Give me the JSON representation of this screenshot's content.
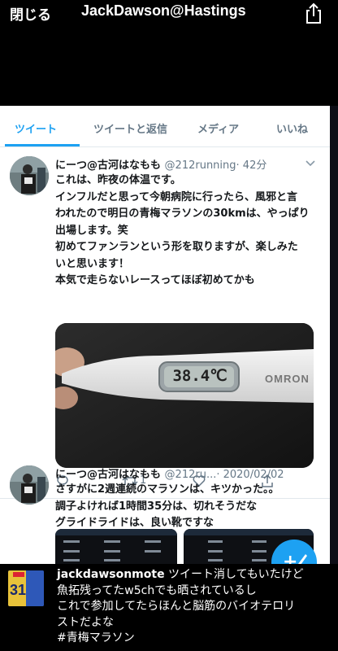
{
  "topbar": {
    "close_label": "閉じる",
    "title": "JackDawson@Hastings",
    "share_icon": "share-icon"
  },
  "tabs": [
    {
      "label": "ツイート",
      "active": true
    },
    {
      "label": "ツイートと返信",
      "active": false
    },
    {
      "label": "メディア",
      "active": false
    },
    {
      "label": "いいね",
      "active": false
    }
  ],
  "tweet1": {
    "name": "にーつ@古河はなもも",
    "handle": "@212running",
    "time": "· 42分",
    "lines": [
      "これは、昨夜の体温です。",
      "インフルだと思って今朝病院に行ったら、風邪と言",
      "われたので明日の青梅マラソンの30kmは、やっぱり",
      "出場します。笑",
      "初めてファンランという形を取りますが、楽しみた",
      "いと思います！",
      "本気で走らないレースってほぼ初めてかも"
    ],
    "thermometer_reading": "38.4℃",
    "thermometer_brand": "OMRON",
    "retweets": "1",
    "brand_color": "#1da1f2"
  },
  "tweet2": {
    "name": "にーつ@古河はなもも",
    "handle": "@212ru...",
    "time": "· 2020/02/02",
    "lines": [
      "さすがに2週連続のマラソンは、キツかった。。",
      "調子よければ1時間35分は、切れそうだな",
      "グライドライドは、良い靴ですな"
    ]
  },
  "comment": {
    "user": "jackdawsonmote",
    "text_first": " ツイート消してもいたけど",
    "lines": [
      "魚拓残ってたw5chでも晒されているし",
      "これで参加してたらほんと脳筋のバイオテロリ",
      "ストだよな",
      "#青梅マラソン"
    ],
    "jersey_number": "31"
  }
}
